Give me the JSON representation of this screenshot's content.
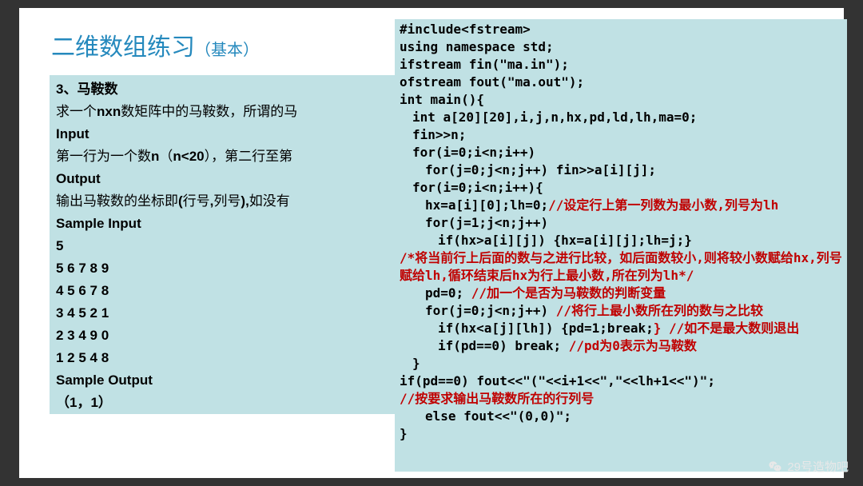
{
  "title_main": "二维数组练习",
  "title_sub": "（基本）",
  "left": [
    "<b>3、马鞍数</b>",
    "求一个<b>nxn</b>数矩阵中的马鞍数，所谓的马",
    "<b>Input</b>",
    "第一行为一个数<b>n</b>（<b>n<20</b>），第二行至第",
    "<b>Output</b>",
    "输出马鞍数的坐标即<b>(</b>行号<b>,</b>列号<b>),</b>如没有",
    "<b>Sample Input</b>",
    "<b>5</b>",
    "<b>5 6 7 8 9</b>",
    "<b>4 5 6 7 8</b>",
    "<b>3 4 5 2 1</b>",
    "<b>2 3 4 9 0</b>",
    "<b>1 2 5 4 8</b>",
    "<b>Sample Output</b>",
    "<b>（1，1）</b>"
  ],
  "code": [
    {
      "i": 0,
      "b": 1,
      "t": "#include<fstream>"
    },
    {
      "i": 0,
      "b": 1,
      "t": "using namespace std;"
    },
    {
      "i": 0,
      "b": 1,
      "t": "ifstream fin(\"ma.in\");"
    },
    {
      "i": 0,
      "b": 1,
      "t": "ofstream fout(\"ma.out\");"
    },
    {
      "i": 0,
      "b": 1,
      "t": "int main(){"
    },
    {
      "i": 1,
      "b": 1,
      "t": "int a[20][20],i,j,n,hx,pd,ld,lh,ma=0;"
    },
    {
      "i": 1,
      "b": 1,
      "t": "fin>>n;"
    },
    {
      "i": 1,
      "b": 1,
      "t": "for(i=0;i<n;i++)"
    },
    {
      "i": 2,
      "b": 1,
      "t": "for(j=0;j<n;j++) fin>>a[i][j];"
    },
    {
      "i": 1,
      "b": 1,
      "t": "for(i=0;i<n;i++){"
    },
    {
      "i": 2,
      "b": 1,
      "t": "hx=a[i][0];lh=0;",
      "r": "//设定行上第一列数为最小数,列号为lh"
    },
    {
      "i": 2,
      "b": 1,
      "t": "for(j=1;j<n;j++)"
    },
    {
      "i": 3,
      "b": 1,
      "t": "if(hx>a[i][j]) {hx=a[i][j];lh=j;}"
    },
    {
      "i": 0,
      "b": 1,
      "r": "/*将当前行上后面的数与之进行比较，如后面数较小,则将较小数赋给hx,列号赋给lh,循环结束后hx为行上最小数,所在列为lh*/"
    },
    {
      "i": 2,
      "b": 1,
      "t": "pd=0; ",
      "r": "//加一个是否为马鞍数的判断变量"
    },
    {
      "i": 2,
      "b": 1,
      "t": "for(j=0;j<n;j++) ",
      "r": "//将行上最小数所在列的数与之比较"
    },
    {
      "i": 3,
      "b": 1,
      "t": "if(hx<a[j][lh]) {pd=1;break;",
      "r": "} //如不是最大数则退出"
    },
    {
      "i": 3,
      "b": 1,
      "t": "if(pd==0) break; ",
      "r": "//pd为0表示为马鞍数"
    },
    {
      "i": 1,
      "b": 1,
      "t": "}"
    },
    {
      "i": 0,
      "b": 1,
      "t": "if(pd==0) fout<<\"(\"<<i+1<<\",\"<<lh+1<<\")\";"
    },
    {
      "i": 0,
      "b": 1,
      "r": "//按要求输出马鞍数所在的行列号"
    },
    {
      "i": 2,
      "b": 1,
      "t": "else fout<<\"(0,0)\";"
    },
    {
      "i": 0,
      "b": 1,
      "t": "}"
    }
  ],
  "watermark": "29号造物吧"
}
